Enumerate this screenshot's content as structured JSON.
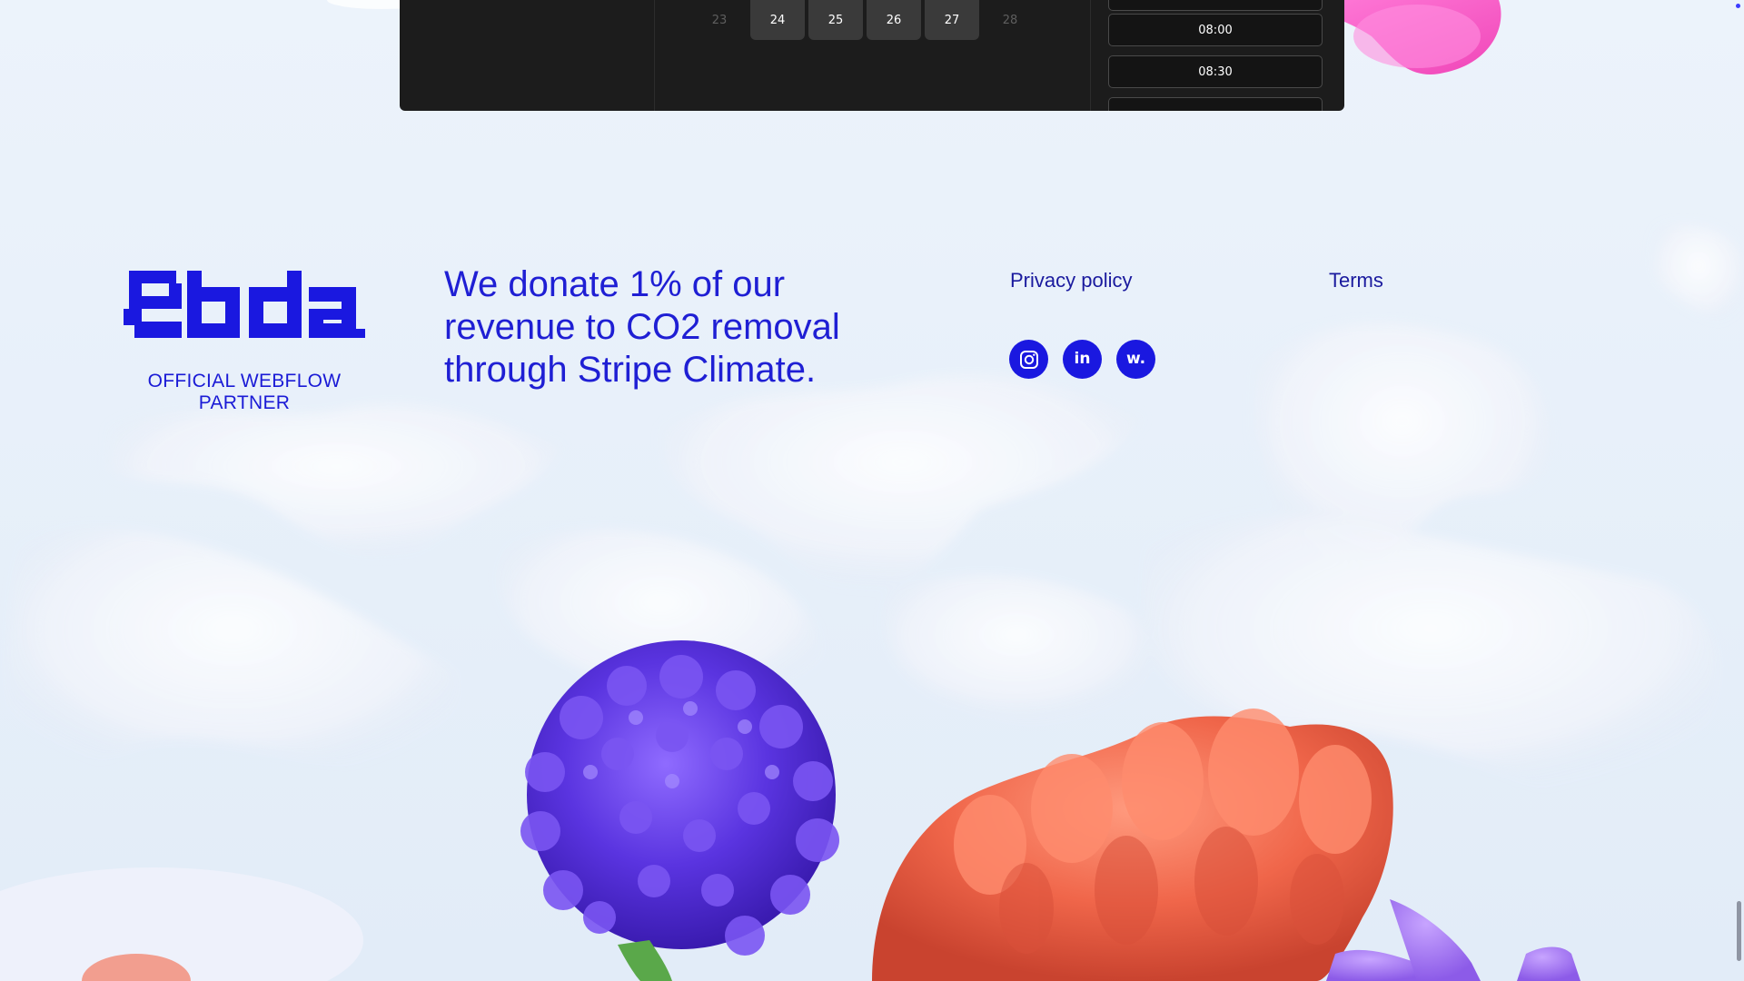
{
  "booking": {
    "days": [
      {
        "label": "23",
        "state": "disabled"
      },
      {
        "label": "24",
        "state": "active"
      },
      {
        "label": "25",
        "state": "active"
      },
      {
        "label": "26",
        "state": "active"
      },
      {
        "label": "27",
        "state": "active"
      },
      {
        "label": "28",
        "state": "disabled"
      }
    ],
    "times": [
      "08:00",
      "08:30"
    ]
  },
  "footer": {
    "partner_text": "OFFICIAL WEBFLOW PARTNER",
    "donation_text": "We donate 1% of our revenue to CO2 removal through Stripe Climate.",
    "links": {
      "privacy": "Privacy policy",
      "terms": "Terms"
    },
    "social": {
      "instagram_icon": "instagram-icon",
      "linkedin_label": "in",
      "webflow_label": "w."
    }
  },
  "colors": {
    "brand_blue": "#1a18e0",
    "text_blue": "#1f1fd4",
    "widget_bg": "#1c1c1c"
  }
}
